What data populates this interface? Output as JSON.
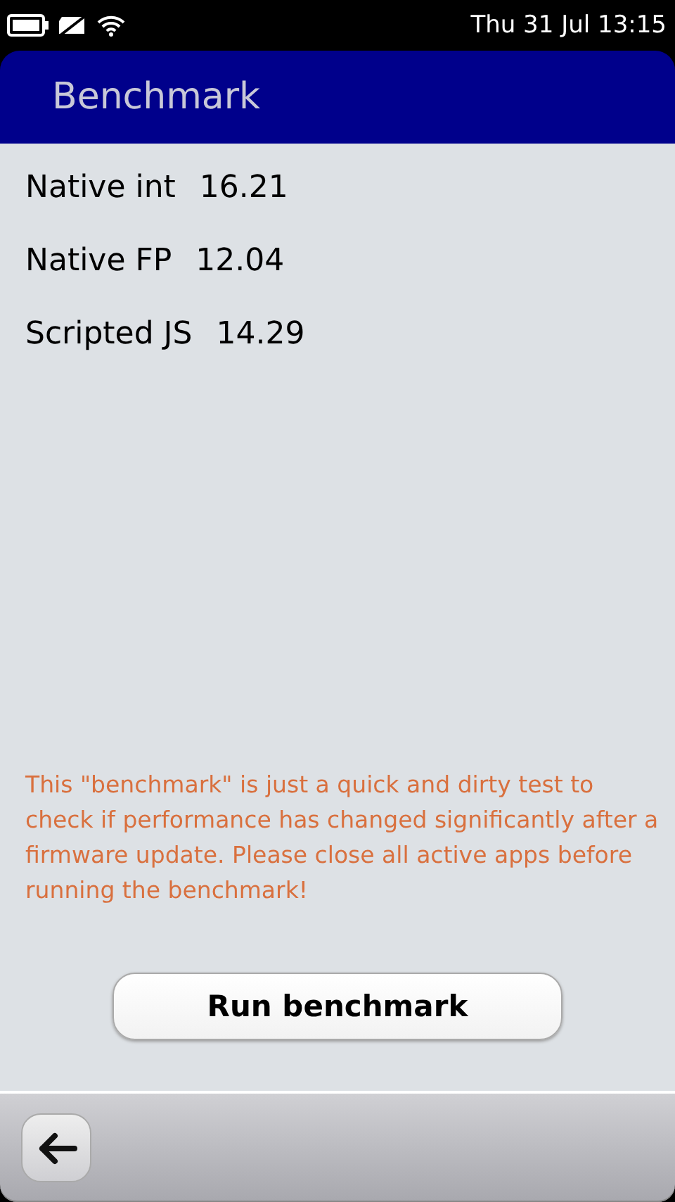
{
  "status_bar": {
    "time": "Thu 31 Jul 13:15"
  },
  "header": {
    "title": "Benchmark"
  },
  "results": [
    {
      "label": "Native int",
      "value": "16.21"
    },
    {
      "label": "Native FP",
      "value": "12.04"
    },
    {
      "label": "Scripted JS",
      "value": "14.29"
    }
  ],
  "note": "This \"benchmark\" is just a quick and dirty test to check if performance has changed significantly after a firmware update. Please close all active apps before running the benchmark!",
  "button": {
    "label": "Run benchmark"
  }
}
